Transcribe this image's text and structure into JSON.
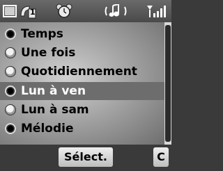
{
  "status_bar": {
    "line_badge": "1",
    "icons": [
      "screen-icon",
      "line-1-icon",
      "alarm-clock-icon",
      "ringer-icon",
      "signal-strength-icon"
    ]
  },
  "menu": {
    "items": [
      {
        "label": "Temps",
        "checked": true,
        "selected": false
      },
      {
        "label": "Une fois",
        "checked": false,
        "selected": false
      },
      {
        "label": "Quotidiennement",
        "checked": false,
        "selected": false
      },
      {
        "label": "Lun à ven",
        "checked": true,
        "selected": true
      },
      {
        "label": "Lun à sam",
        "checked": false,
        "selected": false
      },
      {
        "label": "Mélodie",
        "checked": true,
        "selected": false
      }
    ]
  },
  "softkeys": {
    "select_label": "Sélect.",
    "clear_label": "C"
  }
}
